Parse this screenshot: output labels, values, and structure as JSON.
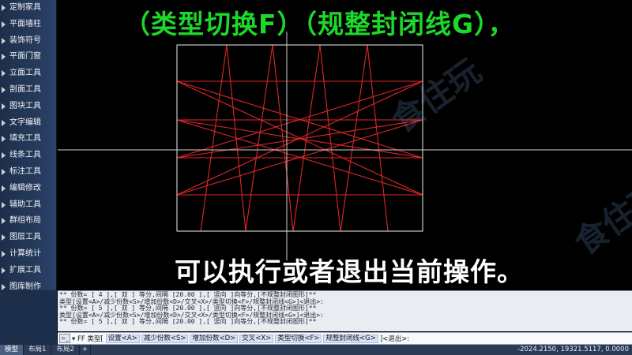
{
  "sidebar": {
    "items": [
      {
        "label": "定制家具"
      },
      {
        "label": "平面墙柱"
      },
      {
        "label": "装饰符号"
      },
      {
        "label": "平面门窗"
      },
      {
        "label": "立面工具"
      },
      {
        "label": "剖面工具"
      },
      {
        "label": "图块工具"
      },
      {
        "label": "文字编辑"
      },
      {
        "label": "填充工具"
      },
      {
        "label": "线条工具"
      },
      {
        "label": "标注工具"
      },
      {
        "label": "编辑修改"
      },
      {
        "label": "辅助工具"
      },
      {
        "label": "群组布局"
      },
      {
        "label": "图层工具"
      },
      {
        "label": "计算统计"
      },
      {
        "label": "扩展工具"
      },
      {
        "label": "图库制作"
      }
    ]
  },
  "captions": {
    "top": "（类型切换F）（规整封闭线G），",
    "bottom": "可以执行或者退出当前操作。"
  },
  "watermark": "食住玩",
  "history": {
    "lines": [
      "** 份数= [ 4 ],[ 双 ] 等分,间隔 [20.00 ],[ 竖向 ]向等分,[不规整封闭图形]**",
      "类型[设置<A>/减少份数<S>/增加份数<D>/交叉<X>/类型切换<F>/规整封闭线<G>]<退出>:",
      "** 份数= [ 5 ],[ 双 ] 等分,间隔 [20.00 ],[ 竖向 ]向等分,[不规整封闭图形]**",
      "类型[设置<A>/减少份数<S>/增加份数<D>/交叉<X>/类型切换<F>/规整封闭线<G>]<退出>:",
      "** 份数= [ 5 ],[ 双 ] 等分,间隔 [20.00 ],[ 竖向 ]向等分,[不规整封闭图形]**"
    ]
  },
  "command": {
    "icon": ">_",
    "prompt": "▾ FF 类型[",
    "options": [
      "设置<A>",
      "减少份数<S>",
      "增加份数<D>",
      "交叉<X>",
      "类型切换<F>",
      "规整封闭线<G>"
    ],
    "tail": "]<退出>:"
  },
  "tabs": [
    {
      "label": "模型",
      "active": true
    },
    {
      "label": "布局1",
      "active": false
    },
    {
      "label": "布局2",
      "active": false
    }
  ],
  "tab_add": "+",
  "coordinates": "-2024.2150, 19321.5117, 0.0000",
  "colors": {
    "caption_top": "#1dd82a",
    "caption_bottom": "#ffffff",
    "lines_red": "#e0262a",
    "frame": "#f2f2f2",
    "crosshair": "#cfcfcf"
  }
}
